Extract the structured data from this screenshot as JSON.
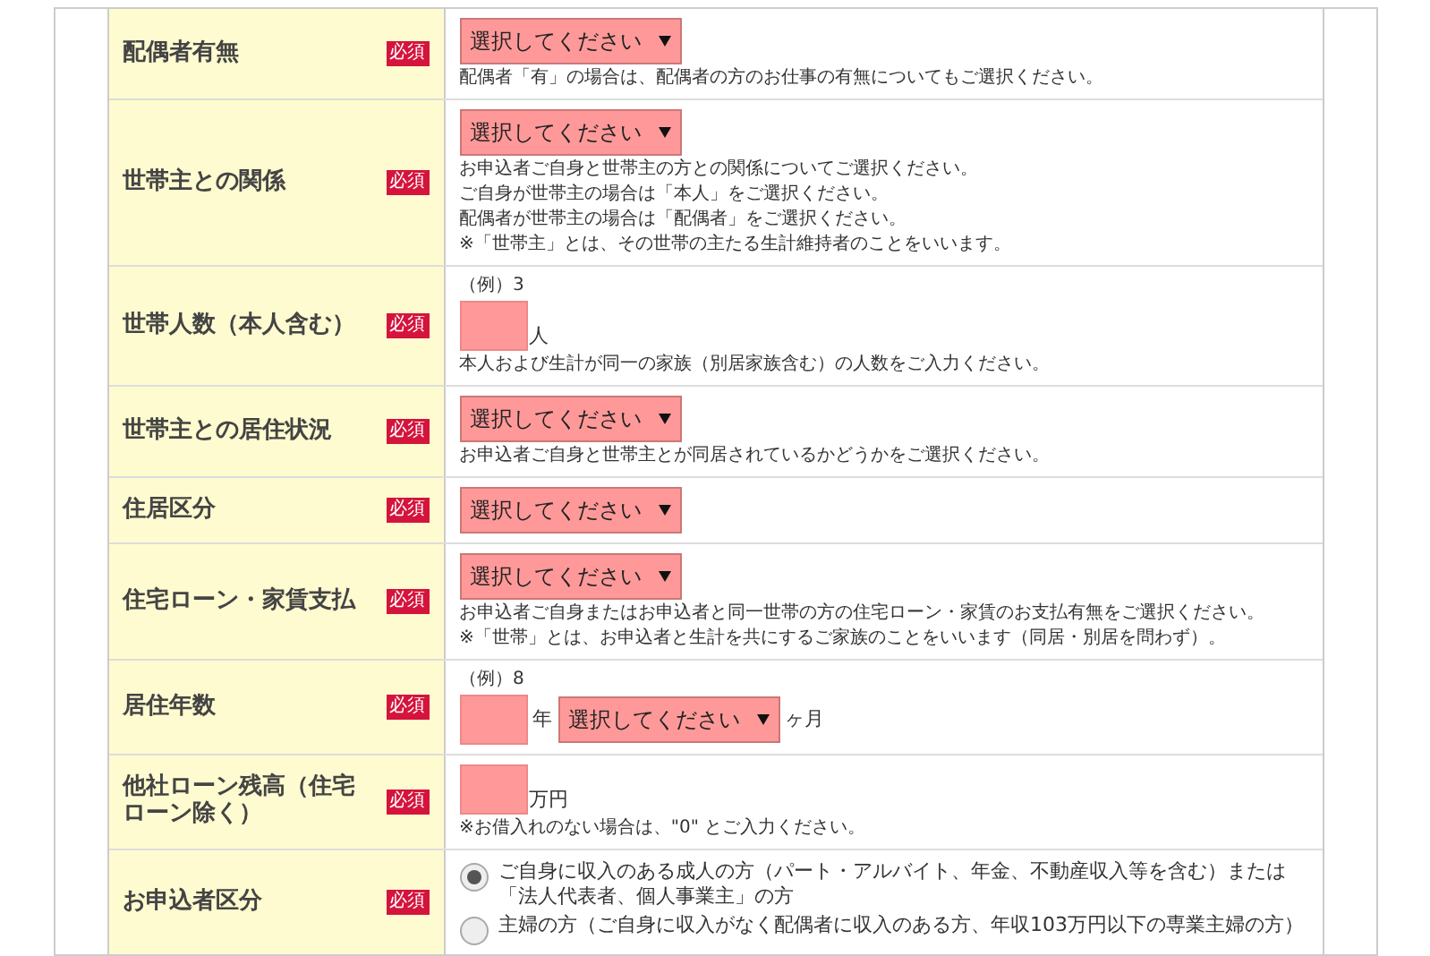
{
  "rows": [
    {
      "label": "配偶者有無",
      "badge": "必須",
      "kind": "select",
      "select": {
        "text": "選択してください"
      },
      "notes": [
        "配偶者「有」の場合は、配偶者の方のお仕事の有無についてもご選択ください。"
      ]
    },
    {
      "label": "世帯主との関係",
      "badge": "必須",
      "kind": "select",
      "select": {
        "text": "選択してください"
      },
      "notes": [
        "お申込者ご自身と世帯主の方との関係についてご選択ください。",
        "ご自身が世帯主の場合は「本人」をご選択ください。",
        "配偶者が世帯主の場合は「配偶者」をご選択ください。",
        "※「世帯主」とは、その世帯の主たる生計維持者のことをいいます。"
      ]
    },
    {
      "label": "世帯人数（本人含む）",
      "badge": "必須",
      "kind": "number",
      "example": "（例）3",
      "unit": "人",
      "notes": [
        "本人および生計が同一の家族（別居家族含む）の人数をご入力ください。"
      ]
    },
    {
      "label": "世帯主との居住状況",
      "badge": "必須",
      "kind": "select",
      "select": {
        "text": "選択してください"
      },
      "notes": [
        "お申込者ご自身と世帯主とが同居されているかどうかをご選択ください。"
      ]
    },
    {
      "label": "住居区分",
      "badge": "必須",
      "kind": "select",
      "select": {
        "text": "選択してください"
      }
    },
    {
      "label": "住宅ローン・家賃支払",
      "badge": "必須",
      "kind": "select",
      "select": {
        "text": "選択してください"
      },
      "notes": [
        "お申込者ご自身またはお申込者と同一世帯の方の住宅ローン・家賃のお支払有無をご選択ください。",
        "※「世帯」とは、お申込者と生計を共にするご家族のことをいいます（同居・別居を問わず）。"
      ]
    },
    {
      "label": "居住年数",
      "badge": "必須",
      "kind": "years",
      "example": "（例）8",
      "unit": "年",
      "select": {
        "text": "選択してください"
      },
      "unit2": "ヶ月"
    },
    {
      "label": "他社ローン残高（住宅ローン除く）",
      "badge": "必須",
      "kind": "number",
      "unit": "万円",
      "notes": [
        "※お借入れのない場合は、\"0\" とご入力ください。"
      ]
    },
    {
      "label": "お申込者区分",
      "badge": "必須",
      "kind": "radio",
      "options": [
        {
          "text": "ご自身に収入のある成人の方（パート・アルバイト、年金、不動産収入等を含む）または「法人代表者、個人事業主」の方",
          "selected": true
        },
        {
          "text": "主婦の方（ご自身に収入がなく配偶者に収入のある方、年収103万円以下の専業主婦の方）",
          "selected": false
        }
      ]
    }
  ]
}
